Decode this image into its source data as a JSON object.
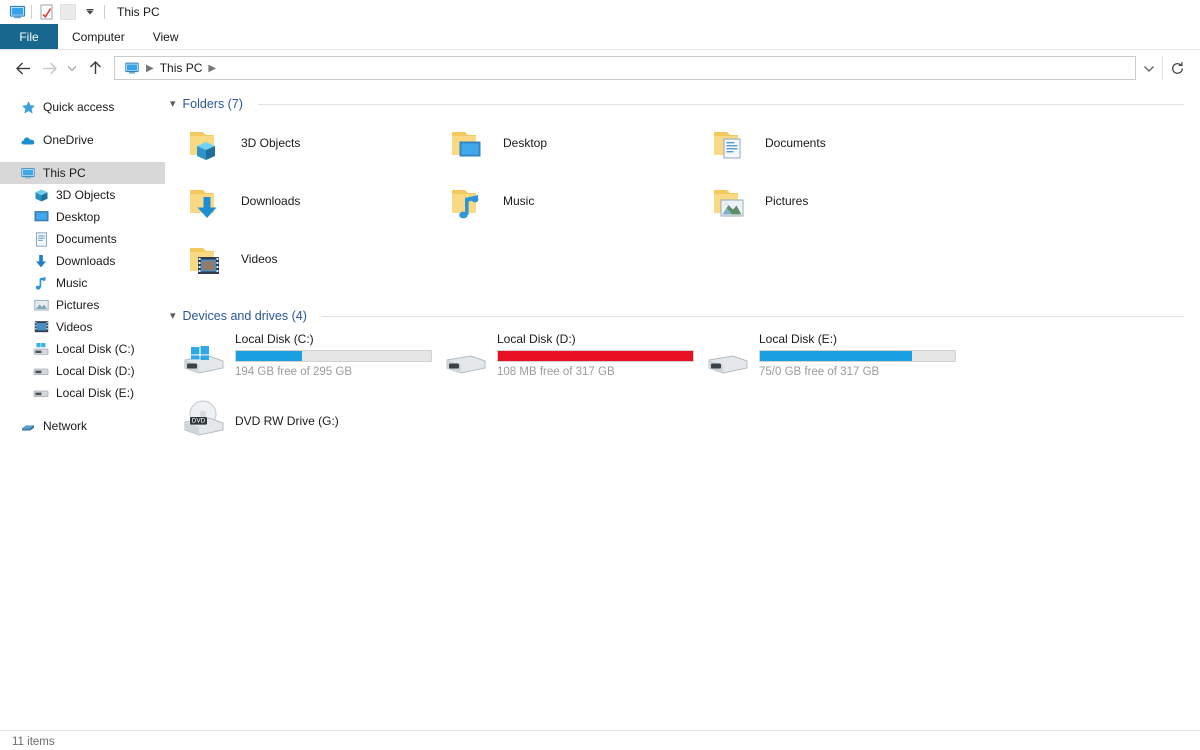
{
  "window": {
    "title": "This PC",
    "qat": [
      {
        "name": "this-pc-icon",
        "icon": "monitor"
      },
      {
        "name": "properties-icon",
        "icon": "properties"
      },
      {
        "name": "blank-icon",
        "icon": "blank"
      },
      {
        "name": "customize-quick-access-toolbar",
        "icon": "chevron-down"
      }
    ]
  },
  "ribbon": {
    "tabs": [
      {
        "label": "File",
        "active": true
      },
      {
        "label": "Computer",
        "active": false
      },
      {
        "label": "View",
        "active": false
      }
    ]
  },
  "address": {
    "back_tooltip": "Back",
    "forward_tooltip": "Forward",
    "recent_tooltip": "Recent locations",
    "up_tooltip": "Up",
    "breadcrumb": [
      {
        "label": "This PC",
        "icon": "monitor"
      }
    ],
    "path_value": "This PC",
    "refresh_tooltip": "Refresh"
  },
  "sidebar": {
    "items": [
      {
        "label": "Quick access",
        "icon": "star",
        "indent": false,
        "selected": false,
        "gap_before": false
      },
      {
        "label": "OneDrive",
        "icon": "cloud",
        "indent": false,
        "selected": false,
        "gap_before": true
      },
      {
        "label": "This PC",
        "icon": "monitor",
        "indent": false,
        "selected": true,
        "gap_before": true
      },
      {
        "label": "3D Objects",
        "icon": "cube",
        "indent": true,
        "selected": false,
        "gap_before": false
      },
      {
        "label": "Desktop",
        "icon": "desktop",
        "indent": true,
        "selected": false,
        "gap_before": false
      },
      {
        "label": "Documents",
        "icon": "document",
        "indent": true,
        "selected": false,
        "gap_before": false
      },
      {
        "label": "Downloads",
        "icon": "download",
        "indent": true,
        "selected": false,
        "gap_before": false
      },
      {
        "label": "Music",
        "icon": "music",
        "indent": true,
        "selected": false,
        "gap_before": false
      },
      {
        "label": "Pictures",
        "icon": "picture",
        "indent": true,
        "selected": false,
        "gap_before": false
      },
      {
        "label": "Videos",
        "icon": "video",
        "indent": true,
        "selected": false,
        "gap_before": false
      },
      {
        "label": "Local Disk (C:)",
        "icon": "windisk",
        "indent": true,
        "selected": false,
        "gap_before": false
      },
      {
        "label": "Local Disk (D:)",
        "icon": "disk",
        "indent": true,
        "selected": false,
        "gap_before": false
      },
      {
        "label": "Local Disk (E:)",
        "icon": "disk",
        "indent": true,
        "selected": false,
        "gap_before": false
      },
      {
        "label": "Network",
        "icon": "network",
        "indent": false,
        "selected": false,
        "gap_before": true
      }
    ]
  },
  "main": {
    "folders_group": {
      "title": "Folders (7)",
      "chevron": "collapse",
      "items": [
        {
          "label": "3D Objects",
          "icon": "folder-3d"
        },
        {
          "label": "Desktop",
          "icon": "folder-desktop"
        },
        {
          "label": "Documents",
          "icon": "folder-documents"
        },
        {
          "label": "Downloads",
          "icon": "folder-downloads"
        },
        {
          "label": "Music",
          "icon": "folder-music"
        },
        {
          "label": "Pictures",
          "icon": "folder-pictures"
        },
        {
          "label": "Videos",
          "icon": "folder-videos"
        }
      ]
    },
    "drives_group": {
      "title": "Devices and drives (4)",
      "chevron": "collapse",
      "items": [
        {
          "label": "Local Disk (C:)",
          "icon": "drive-windows",
          "has_bar": true,
          "fill_percent": 34,
          "bar_color": "#1a9fe0",
          "free_text": "194 GB free of 295 GB"
        },
        {
          "label": "Local Disk (D:)",
          "icon": "drive",
          "has_bar": true,
          "fill_percent": 100,
          "bar_color": "#e81123",
          "free_text": "108 MB free of 317 GB"
        },
        {
          "label": "Local Disk (E:)",
          "icon": "drive",
          "has_bar": true,
          "fill_percent": 78,
          "bar_color": "#1a9fe0",
          "free_text": "75/0 GB free of 317 GB"
        },
        {
          "label": "DVD RW Drive (G:)",
          "icon": "drive-dvd",
          "has_bar": false,
          "fill_percent": 0,
          "bar_color": "",
          "free_text": ""
        }
      ]
    }
  },
  "status": {
    "items_count": "11 items"
  },
  "colors": {
    "file_tab": "#17678e",
    "group_header": "#2a5699",
    "selection": "#d8d8d8",
    "bar_blue": "#1a9fe0",
    "bar_red": "#e81123",
    "folder_yellow": "#f7cf70"
  }
}
